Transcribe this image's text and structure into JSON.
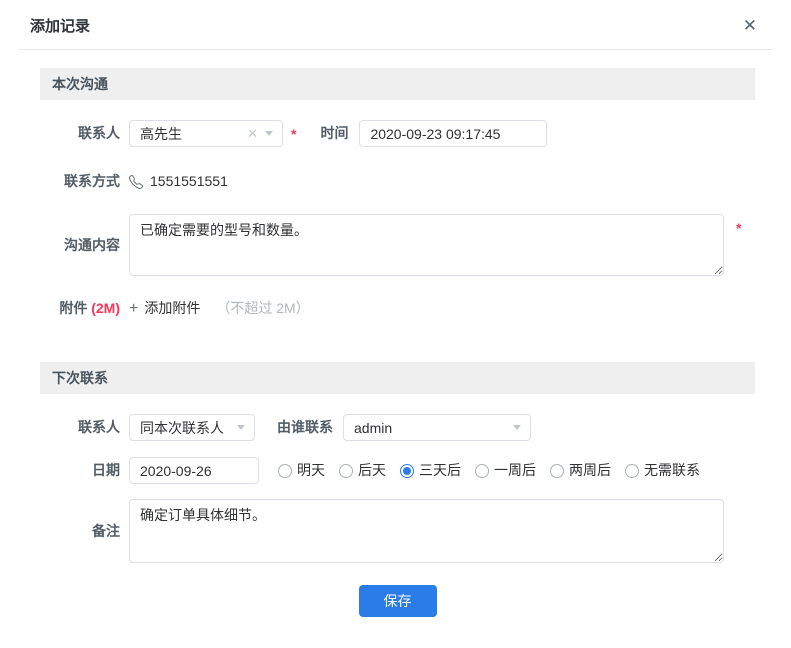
{
  "dialog": {
    "title": "添加记录",
    "close_glyph": "✕"
  },
  "sections": {
    "current": {
      "header": "本次沟通",
      "contact_label": "联系人",
      "contact_value": "高先生",
      "clear_glyph": "✕",
      "required_mark": "*",
      "time_label": "时间",
      "time_value": "2020-09-23 09:17:45",
      "phone_label": "联系方式",
      "phone_value": "1551551551",
      "content_label": "沟通内容",
      "content_value": "已确定需要的型号和数量。",
      "attachment_label": "附件",
      "attachment_limit": "(2M)",
      "plus_glyph": "+",
      "add_attachment_label": "添加附件",
      "attachment_hint": "（不超过 2M）"
    },
    "next": {
      "header": "下次联系",
      "contact_label": "联系人",
      "contact_value": "同本次联系人",
      "assignee_label": "由谁联系",
      "assignee_value": "admin",
      "date_label": "日期",
      "date_value": "2020-09-26",
      "date_options": [
        {
          "label": "明天",
          "selected": false
        },
        {
          "label": "后天",
          "selected": false
        },
        {
          "label": "三天后",
          "selected": true
        },
        {
          "label": "一周后",
          "selected": false
        },
        {
          "label": "两周后",
          "selected": false
        },
        {
          "label": "无需联系",
          "selected": false
        }
      ],
      "note_label": "备注",
      "note_value": "确定订单具体细节。"
    }
  },
  "footer": {
    "save_label": "保存"
  },
  "colors": {
    "accent": "#2b7ce9",
    "danger": "#f5365c",
    "section_bg": "#efefef"
  }
}
